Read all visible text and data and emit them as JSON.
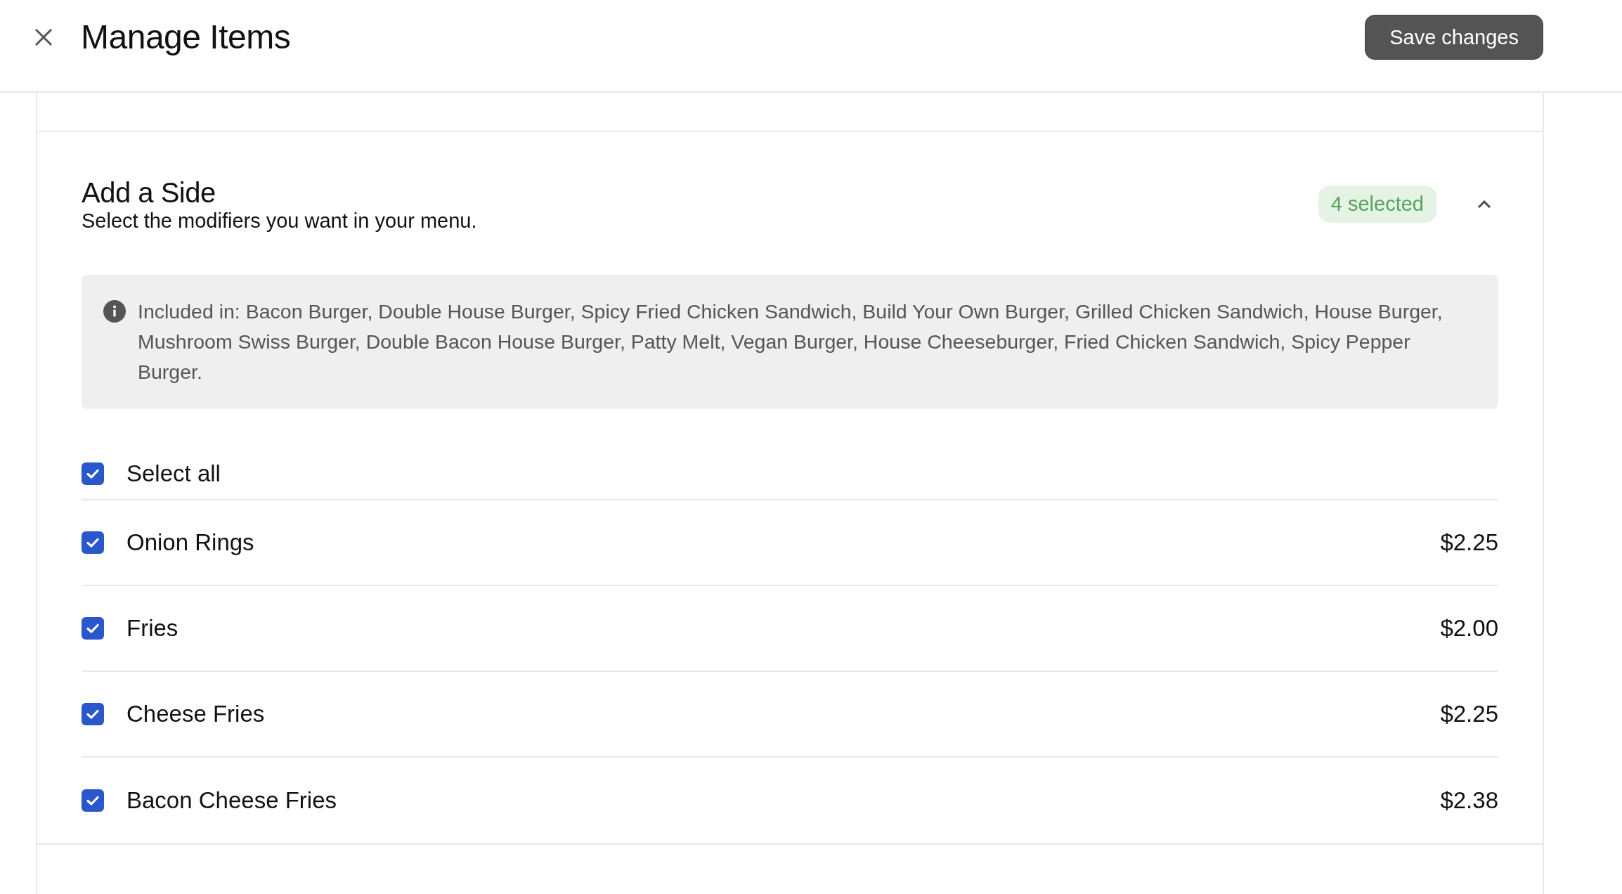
{
  "header": {
    "title": "Manage Items",
    "save_label": "Save changes"
  },
  "section": {
    "title": "Add a Side",
    "subtitle": "Select the modifiers you want in your menu.",
    "selection_count": "4 selected",
    "expanded": true,
    "note": "Included in: Bacon Burger, Double House Burger, Spicy Fried Chicken Sandwich, Build Your Own Burger, Grilled Chicken Sandwich, House Burger, Mushroom Swiss Burger, Double Bacon House Burger, Patty Melt, Vegan Burger, House Cheeseburger, Fried Chicken Sandwich, Spicy Pepper Burger.",
    "select_all": {
      "label": "Select all",
      "checked": true
    },
    "items": [
      {
        "name": "Onion Rings",
        "price": "$2.25",
        "checked": true
      },
      {
        "name": "Fries",
        "price": "$2.00",
        "checked": true
      },
      {
        "name": "Cheese Fries",
        "price": "$2.25",
        "checked": true
      },
      {
        "name": "Bacon Cheese Fries",
        "price": "$2.38",
        "checked": true
      }
    ]
  }
}
